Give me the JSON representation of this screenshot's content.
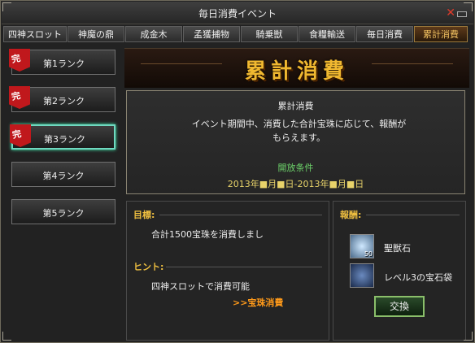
{
  "window": {
    "title": "毎日消費イベント"
  },
  "tabs": [
    {
      "label": "四神スロット"
    },
    {
      "label": "神魔の鼎"
    },
    {
      "label": "成金木"
    },
    {
      "label": "孟獲捕物"
    },
    {
      "label": "騎乗獣"
    },
    {
      "label": "食糧輸送"
    },
    {
      "label": "毎日消費"
    },
    {
      "label": "累計消費"
    }
  ],
  "sidebar": {
    "completed_mark": "完",
    "ranks": [
      {
        "label": "第1ランク"
      },
      {
        "label": "第2ランク"
      },
      {
        "label": "第3ランク"
      },
      {
        "label": "第4ランク"
      },
      {
        "label": "第5ランク"
      }
    ]
  },
  "banner": {
    "heading": "累計消費"
  },
  "info": {
    "title": "累計消費",
    "description": "イベント期間中、消費した合計宝珠に応じて、報酬がもらえます。",
    "period_title": "開放条件",
    "period_dates": "2013年■月■日-2013年■月■日"
  },
  "goal": {
    "label": "目標:",
    "text": "合計1500宝珠を消費しまし",
    "hint_label": "ヒント:",
    "hint_text": "四神スロットで消費可能",
    "link": ">>宝珠消費"
  },
  "reward": {
    "label": "報酬:",
    "items": [
      {
        "name": "聖獣石",
        "count": "50",
        "icon": "beast-stone-icon"
      },
      {
        "name": "レベル3の宝石袋",
        "icon": "gem-bag-icon"
      }
    ],
    "exchange_button": "交換"
  },
  "colors": {
    "accent": "#f0b830",
    "hint": "#f0c040",
    "link": "#ff9a1a",
    "green": "#6dd36a",
    "active_border": "#6fd9c0",
    "badge": "#c0181c"
  }
}
